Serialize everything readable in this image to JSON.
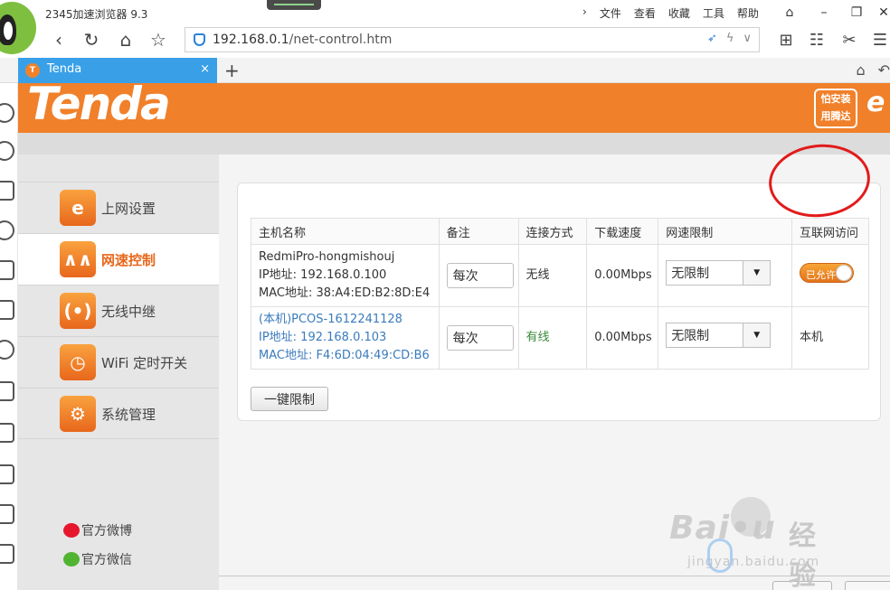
{
  "browser": {
    "title": "2345加速浏览器 9.3",
    "menu": [
      "文件",
      "查看",
      "收藏",
      "工具",
      "帮助"
    ],
    "url_host": "192.168.0.1",
    "url_path": "/net-control.htm",
    "tab_label": "Tenda",
    "tab_close": "×",
    "new_tab": "+"
  },
  "banner": {
    "logo": "Tenda",
    "slogan_line1": "怕安装",
    "slogan_line2": "用腾达"
  },
  "sidebar": {
    "items": [
      {
        "label": "上网设置",
        "icon": "e"
      },
      {
        "label": "网速控制",
        "icon": "∧∧"
      },
      {
        "label": "无线中继",
        "icon": "(•)"
      },
      {
        "label": "WiFi 定时开关",
        "icon": "◷"
      },
      {
        "label": "系统管理",
        "icon": "⚙"
      }
    ],
    "social": [
      "官方微博",
      "官方微信"
    ]
  },
  "table": {
    "headers": [
      "主机名称",
      "备注",
      "连接方式",
      "下载速度",
      "网速限制",
      "互联网访问"
    ],
    "rows": [
      {
        "host": "RedmiPro-hongmishouj",
        "ip": "IP地址: 192.168.0.100",
        "mac": "MAC地址: 38:A4:ED:B2:8D:E4",
        "note": "每次",
        "connection": "无线",
        "speed": "0.00Mbps",
        "limit": "无限制",
        "access": "已允许"
      },
      {
        "host": "(本机)PCOS-1612241128",
        "ip": "IP地址: 192.168.0.103",
        "mac": "MAC地址: F4:6D:04:49:CD:B6",
        "note": "每次",
        "connection": "有线",
        "speed": "0.00Mbps",
        "limit": "无限制",
        "access": "本机"
      }
    ]
  },
  "buttons": {
    "one_click_limit": "一键限制"
  },
  "watermark": {
    "logo": "Bai•u",
    "text": "经验",
    "url": "jingyan.baidu.com"
  },
  "colors": {
    "brand_orange": "#f0802a",
    "tab_blue": "#39a0e8",
    "highlight_red": "#e21b1b"
  }
}
